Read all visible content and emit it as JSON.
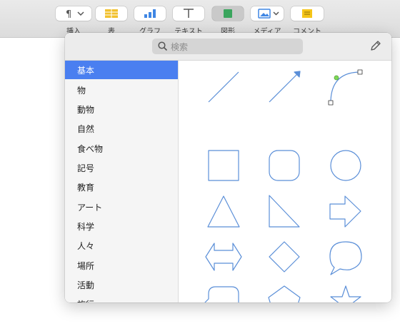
{
  "toolbar": {
    "items": [
      {
        "label": "挿入",
        "icon": "paragraph-icon"
      },
      {
        "label": "表",
        "icon": "table-icon"
      },
      {
        "label": "グラフ",
        "icon": "chart-icon"
      },
      {
        "label": "テキスト",
        "icon": "text-icon"
      },
      {
        "label": "図形",
        "icon": "shape-icon"
      },
      {
        "label": "メディア",
        "icon": "media-icon"
      },
      {
        "label": "コメント",
        "icon": "comment-icon"
      }
    ],
    "colors": {
      "table": "#f2c12e",
      "chart": "#3f86e4",
      "shape": "#3aa55d",
      "comment": "#f5c518"
    }
  },
  "shapes_popover": {
    "search_placeholder": "検索",
    "categories": [
      "基本",
      "物",
      "動物",
      "自然",
      "食べ物",
      "記号",
      "教育",
      "アート",
      "科学",
      "人々",
      "場所",
      "活動",
      "旅行"
    ],
    "selected_category": "基本",
    "selected_color": "#4a7ff0",
    "shape_stroke_color": "#5b8fd8",
    "shapes": [
      "line",
      "arrow-line",
      "curve",
      "square",
      "rounded-square",
      "circle",
      "triangle",
      "right-triangle",
      "arrow",
      "double-arrow",
      "diamond",
      "speech-bubble",
      "callout-square",
      "pentagon",
      "star"
    ]
  }
}
